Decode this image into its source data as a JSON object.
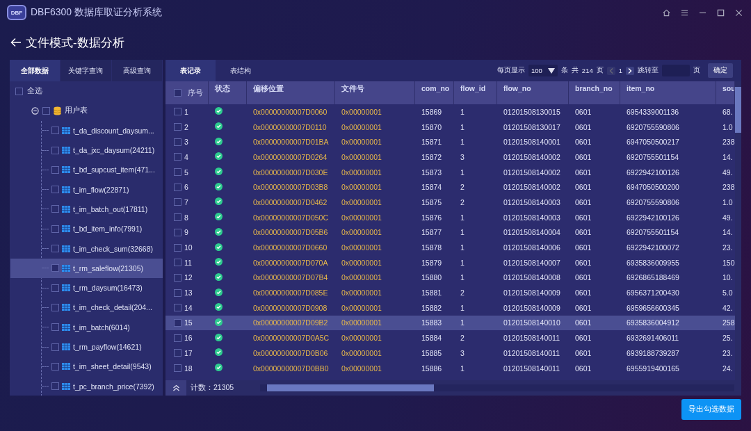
{
  "window": {
    "title": "DBF6300 数据库取证分析系统",
    "logo": "DBF"
  },
  "page": {
    "title": "文件模式-数据分析"
  },
  "left_tabs": [
    {
      "label": "全部数据",
      "selected": true
    },
    {
      "label": "关键字查询",
      "selected": false
    },
    {
      "label": "高级查询",
      "selected": false
    }
  ],
  "select_all": {
    "label": "全选",
    "checked": false
  },
  "tree": [
    {
      "label": "用户表",
      "kind": "database",
      "expanded": true,
      "checked": false,
      "selected": false,
      "children": [
        {
          "label": "t_da_discount_daysum...",
          "kind": "table",
          "checked": false,
          "selected": false
        },
        {
          "label": "t_da_jxc_daysum(24211)",
          "kind": "table",
          "checked": false,
          "selected": false
        },
        {
          "label": "t_bd_supcust_item(471...",
          "kind": "table",
          "checked": false,
          "selected": false
        },
        {
          "label": "t_im_flow(22871)",
          "kind": "table",
          "checked": false,
          "selected": false
        },
        {
          "label": "t_im_batch_out(17811)",
          "kind": "table",
          "checked": false,
          "selected": false
        },
        {
          "label": "t_bd_item_info(7991)",
          "kind": "table",
          "checked": false,
          "selected": false
        },
        {
          "label": "t_im_check_sum(32668)",
          "kind": "table",
          "checked": false,
          "selected": false
        },
        {
          "label": "t_rm_saleflow(21305)",
          "kind": "table",
          "checked": false,
          "selected": true
        },
        {
          "label": "t_rm_daysum(16473)",
          "kind": "table",
          "checked": false,
          "selected": false
        },
        {
          "label": "t_im_check_detail(204...",
          "kind": "table",
          "checked": false,
          "selected": false
        },
        {
          "label": "t_im_batch(6014)",
          "kind": "table",
          "checked": false,
          "selected": false
        },
        {
          "label": "t_rm_payflow(14621)",
          "kind": "table",
          "checked": false,
          "selected": false
        },
        {
          "label": "t_im_sheet_detail(9543)",
          "kind": "table",
          "checked": false,
          "selected": false
        },
        {
          "label": "t_pc_branch_price(7392)",
          "kind": "table",
          "checked": false,
          "selected": false
        }
      ]
    }
  ],
  "right_tabs": [
    {
      "label": "表记录",
      "selected": true
    },
    {
      "label": "表结构",
      "selected": false
    }
  ],
  "pager": {
    "per_page_label": "每页显示",
    "per_page": "100",
    "per_page_unit": "条",
    "total_label": "共",
    "total_pages": "214",
    "pages_unit": "页",
    "current_page": "1",
    "jump_label": "跳转至",
    "jump_unit": "页",
    "confirm": "确定"
  },
  "table": {
    "all_checked": false,
    "columns": [
      "序号",
      "状态",
      "偏移位置",
      "文件号",
      "com_no",
      "flow_id",
      "flow_no",
      "branch_no",
      "item_no",
      "sou"
    ],
    "rows": [
      {
        "checked": false,
        "selected": false,
        "status_ok": true,
        "cells": [
          "1",
          "",
          "0x00000000007D0060",
          "0x00000001",
          "15869",
          "1",
          "01201508130015",
          "0601",
          "6954339001136",
          "68."
        ]
      },
      {
        "checked": false,
        "selected": false,
        "status_ok": true,
        "cells": [
          "2",
          "",
          "0x00000000007D0110",
          "0x00000001",
          "15870",
          "1",
          "01201508130017",
          "0601",
          "6920755590806",
          "1.0"
        ]
      },
      {
        "checked": false,
        "selected": false,
        "status_ok": true,
        "cells": [
          "3",
          "",
          "0x00000000007D01BA",
          "0x00000001",
          "15871",
          "1",
          "01201508140001",
          "0601",
          "6947050500217",
          "238"
        ]
      },
      {
        "checked": false,
        "selected": false,
        "status_ok": true,
        "cells": [
          "4",
          "",
          "0x00000000007D0264",
          "0x00000001",
          "15872",
          "3",
          "01201508140002",
          "0601",
          "6920755501154",
          "14."
        ]
      },
      {
        "checked": false,
        "selected": false,
        "status_ok": true,
        "cells": [
          "5",
          "",
          "0x00000000007D030E",
          "0x00000001",
          "15873",
          "1",
          "01201508140002",
          "0601",
          "6922942100126",
          "49."
        ]
      },
      {
        "checked": false,
        "selected": false,
        "status_ok": true,
        "cells": [
          "6",
          "",
          "0x00000000007D03B8",
          "0x00000001",
          "15874",
          "2",
          "01201508140002",
          "0601",
          "6947050500200",
          "238"
        ]
      },
      {
        "checked": false,
        "selected": false,
        "status_ok": true,
        "cells": [
          "7",
          "",
          "0x00000000007D0462",
          "0x00000001",
          "15875",
          "2",
          "01201508140003",
          "0601",
          "6920755590806",
          "1.0"
        ]
      },
      {
        "checked": false,
        "selected": false,
        "status_ok": true,
        "cells": [
          "8",
          "",
          "0x00000000007D050C",
          "0x00000001",
          "15876",
          "1",
          "01201508140003",
          "0601",
          "6922942100126",
          "49."
        ]
      },
      {
        "checked": false,
        "selected": false,
        "status_ok": true,
        "cells": [
          "9",
          "",
          "0x00000000007D05B6",
          "0x00000001",
          "15877",
          "1",
          "01201508140004",
          "0601",
          "6920755501154",
          "14."
        ]
      },
      {
        "checked": false,
        "selected": false,
        "status_ok": true,
        "cells": [
          "10",
          "",
          "0x00000000007D0660",
          "0x00000001",
          "15878",
          "1",
          "01201508140006",
          "0601",
          "6922942100072",
          "23."
        ]
      },
      {
        "checked": false,
        "selected": false,
        "status_ok": true,
        "cells": [
          "11",
          "",
          "0x00000000007D070A",
          "0x00000001",
          "15879",
          "1",
          "01201508140007",
          "0601",
          "6935836009955",
          "150"
        ]
      },
      {
        "checked": false,
        "selected": false,
        "status_ok": true,
        "cells": [
          "12",
          "",
          "0x00000000007D07B4",
          "0x00000001",
          "15880",
          "1",
          "01201508140008",
          "0601",
          "6926865188469",
          "10."
        ]
      },
      {
        "checked": false,
        "selected": false,
        "status_ok": true,
        "cells": [
          "13",
          "",
          "0x00000000007D085E",
          "0x00000001",
          "15881",
          "2",
          "01201508140009",
          "0601",
          "6956371200430",
          "5.0"
        ]
      },
      {
        "checked": false,
        "selected": false,
        "status_ok": true,
        "cells": [
          "14",
          "",
          "0x00000000007D0908",
          "0x00000001",
          "15882",
          "1",
          "01201508140009",
          "0601",
          "6959656600345",
          "42."
        ]
      },
      {
        "checked": false,
        "selected": true,
        "status_ok": true,
        "cells": [
          "15",
          "",
          "0x00000000007D09B2",
          "0x00000001",
          "15883",
          "1",
          "01201508140010",
          "0601",
          "6935836004912",
          "258"
        ]
      },
      {
        "checked": false,
        "selected": false,
        "status_ok": true,
        "cells": [
          "16",
          "",
          "0x00000000007D0A5C",
          "0x00000001",
          "15884",
          "2",
          "01201508140011",
          "0601",
          "6932691406011",
          "25."
        ]
      },
      {
        "checked": false,
        "selected": false,
        "status_ok": true,
        "cells": [
          "17",
          "",
          "0x00000000007D0B06",
          "0x00000001",
          "15885",
          "3",
          "01201508140011",
          "0601",
          "6939188739287",
          "23."
        ]
      },
      {
        "checked": false,
        "selected": false,
        "status_ok": true,
        "cells": [
          "18",
          "",
          "0x00000000007D0BB0",
          "0x00000001",
          "15886",
          "1",
          "01201508140011",
          "0601",
          "6955919400165",
          "24."
        ]
      }
    ]
  },
  "footer": {
    "count": "计数：21305"
  },
  "export_button": "导出勾选数据"
}
